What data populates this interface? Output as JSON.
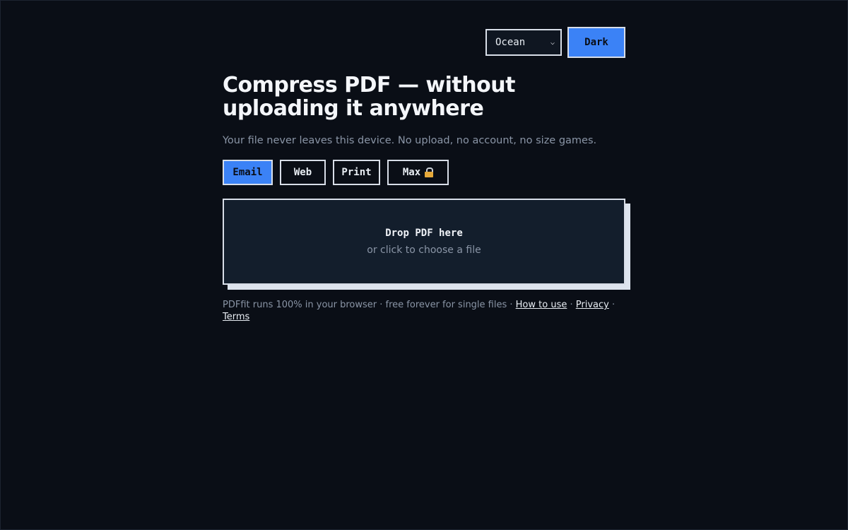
{
  "header": {
    "theme_select": {
      "selected": "Ocean"
    },
    "mode_button_label": "Dark"
  },
  "main": {
    "title": "Compress PDF — without uploading it anywhere",
    "subtitle": "Your file never leaves this device. No upload, no account, no size games.",
    "presets": [
      {
        "label": "Email",
        "active": true
      },
      {
        "label": "Web",
        "active": false
      },
      {
        "label": "Print",
        "active": false
      },
      {
        "label": "Max",
        "active": false,
        "icon": "lock-icon"
      }
    ],
    "dropzone": {
      "title": "Drop PDF here",
      "subtitle": "or click to choose a file"
    }
  },
  "footer": {
    "text": "PDFfit runs 100% in your browser · free forever for single files · ",
    "separator": " · ",
    "links": {
      "how_to_use": "How to use",
      "privacy": "Privacy",
      "terms": "Terms"
    }
  },
  "colors": {
    "background": "#0a0e16",
    "accent": "#3b82f6",
    "dropzone_bg": "#131e2c",
    "muted_text": "#8a95a6"
  }
}
